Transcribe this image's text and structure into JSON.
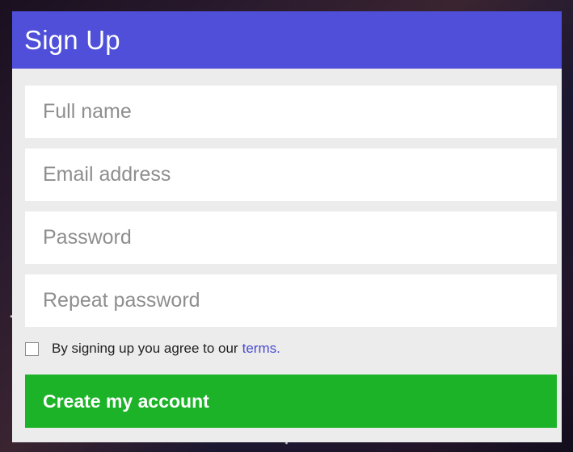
{
  "signup": {
    "title": "Sign Up",
    "fields": {
      "full_name_placeholder": "Full name",
      "email_placeholder": "Email address",
      "password_placeholder": "Password",
      "repeat_password_placeholder": "Repeat password"
    },
    "terms": {
      "text": "By signing up you agree to our",
      "link_text": "terms.",
      "checked": false
    },
    "submit_label": "Create my account"
  },
  "colors": {
    "header": "#4f4fd9",
    "panel": "#ececec",
    "field_bg": "#ffffff",
    "submit": "#1db329",
    "link": "#4a4ad0"
  }
}
